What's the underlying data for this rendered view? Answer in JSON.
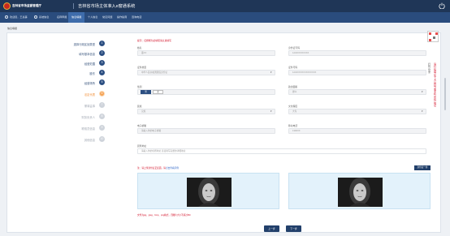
{
  "header": {
    "org_name": "吉林省市场监督管理厅",
    "system_title": "吉林省市场主体准入e窗通系统"
  },
  "nav": {
    "items": [
      {
        "label": "欢迎您，王总事"
      },
      {
        "label": "系统信息"
      },
      {
        "label": "名称申报"
      },
      {
        "label": "信息填报"
      },
      {
        "label": "个人信息"
      },
      {
        "label": "常见问题"
      },
      {
        "label": "操作指南"
      },
      {
        "label": "咨询电话"
      }
    ]
  },
  "breadcrumb": "信息填报",
  "steps": [
    {
      "num": "1",
      "label": "选择行政区划类型",
      "state": "done"
    },
    {
      "num": "2",
      "label": "填写基本信息",
      "state": "done"
    },
    {
      "num": "3",
      "label": "经营范围",
      "state": "done"
    },
    {
      "num": "4",
      "label": "股东",
      "state": "done"
    },
    {
      "num": "5",
      "label": "经营场所",
      "state": "done"
    },
    {
      "num": "6",
      "label": "法定代表",
      "state": "current"
    },
    {
      "num": "7",
      "label": "董事监事",
      "state": "pending"
    },
    {
      "num": "8",
      "label": "财务负责人",
      "state": "pending"
    },
    {
      "num": "9",
      "label": "联络员信息",
      "state": "pending"
    },
    {
      "num": "10",
      "label": "其他信息",
      "state": "pending"
    }
  ],
  "form": {
    "hint": "提示：红框框为必填项请认真填写",
    "name": {
      "label": "姓名",
      "value": "董XX"
    },
    "id_number": {
      "label": "身份证号码",
      "value": "1234XXXXXXXX"
    },
    "id_type": {
      "label": "证件类型",
      "value": "中华人民共和国居民身份证"
    },
    "id_number2": {
      "label": "证件号码",
      "value": "1234XXXXXXXXXXXXX"
    },
    "gender": {
      "label": "性别",
      "option_on": "男",
      "option_off": "女"
    },
    "politics": {
      "label": "政治面貌",
      "value": "群众"
    },
    "ethnic": {
      "label": "民族",
      "value": "汉族"
    },
    "education": {
      "label": "文化程度",
      "value": "大专"
    },
    "phone": {
      "label": "电子邮箱",
      "value": "请输入你的电子邮箱"
    },
    "mobile": {
      "label": "移动电话",
      "value": "1390XX"
    },
    "address": {
      "label": "居所地址",
      "value": "请输入你的住所地址 直接填写完整的详细地址"
    },
    "upload_note_red": "注：请上传身份证正反面，请",
    "upload_note_blue": "点击查看示例",
    "upload_button": "身份证一并",
    "file_hint": "文件为jpg、jpeg、bmp、png格式，且图片大小不超过2M"
  },
  "buttons": {
    "prev": "上一步",
    "next": "下一步"
  },
  "right_panel": {
    "vertical_red": "请扫码填写下方网站或手机号码验证",
    "vertical_gray": "扫码登录"
  },
  "colors": {
    "topbar": "#1f3657",
    "navbar": "#2a4c7d",
    "primary": "#22406b",
    "current_step": "#f5a355",
    "required": "#d0021b"
  }
}
